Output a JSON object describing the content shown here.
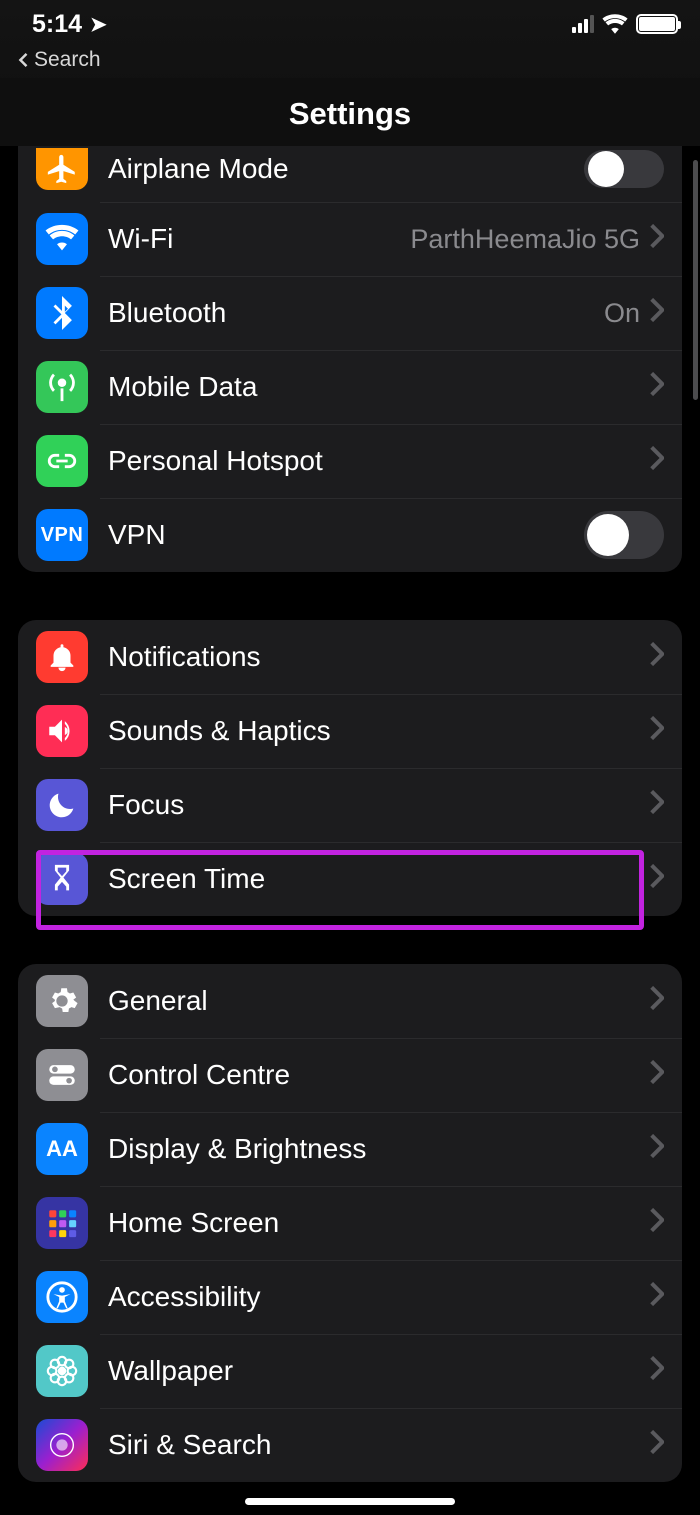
{
  "status": {
    "time": "5:14",
    "back_label": "Search"
  },
  "header": {
    "title": "Settings"
  },
  "group1": {
    "airplane": "Airplane Mode",
    "wifi": "Wi-Fi",
    "wifi_value": "ParthHeemaJio 5G",
    "bluetooth": "Bluetooth",
    "bluetooth_value": "On",
    "mobile": "Mobile Data",
    "hotspot": "Personal Hotspot",
    "vpn": "VPN"
  },
  "group2": {
    "notifications": "Notifications",
    "sounds": "Sounds & Haptics",
    "focus": "Focus",
    "screentime": "Screen Time"
  },
  "group3": {
    "general": "General",
    "control": "Control Centre",
    "display": "Display & Brightness",
    "home": "Home Screen",
    "accessibility": "Accessibility",
    "wallpaper": "Wallpaper",
    "siri": "Siri & Search"
  }
}
